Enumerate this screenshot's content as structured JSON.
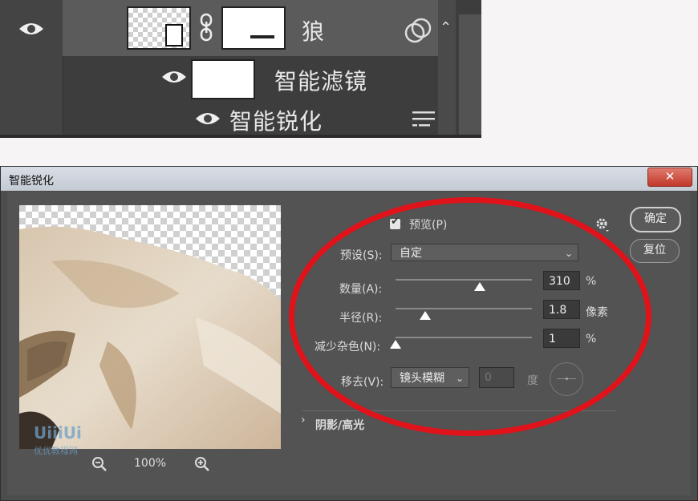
{
  "layers_panel": {
    "layer_name": "狼",
    "smart_filters_label": "智能滤镜",
    "filter_name": "智能锐化"
  },
  "dialog": {
    "title": "智能锐化",
    "close_label": "✕",
    "zoom_level": "100%",
    "preview_label": "预览(P)",
    "preview_checked": true,
    "ok_label": "确定",
    "reset_label": "复位",
    "preset_label": "预设(S):",
    "preset_value": "自定",
    "amount_label": "数量(A):",
    "amount_value": "310",
    "amount_unit": "%",
    "amount_fraction": 0.62,
    "radius_label": "半径(R):",
    "radius_value": "1.8",
    "radius_unit": "像素",
    "radius_fraction": 0.22,
    "noise_label": "减少杂色(N):",
    "noise_value": "1",
    "noise_unit": "%",
    "noise_fraction": 0.0,
    "remove_label": "移去(V):",
    "remove_value": "镜头模糊",
    "angle_value": "0",
    "angle_unit": "度",
    "shadows_highlights_label": "阴影/高光"
  },
  "watermark": {
    "logo_text": "UiiiUi",
    "site_text": "优优教程网"
  },
  "colors": {
    "annotation_red": "#e0121a",
    "dialog_bg": "#535353",
    "panel_bg": "#3d3d3d"
  }
}
